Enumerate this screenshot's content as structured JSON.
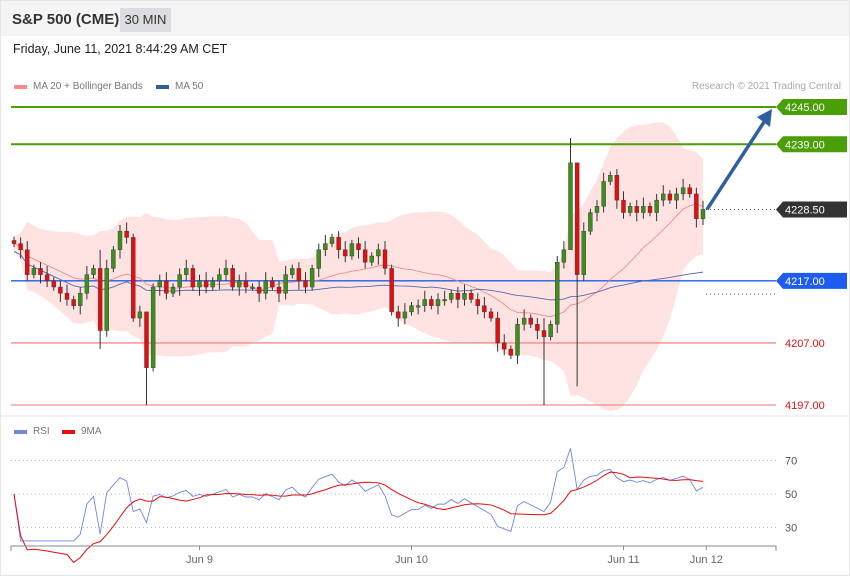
{
  "header": {
    "title": "S&P 500 (CME)",
    "timeframe": "30 MIN",
    "date": "Friday, June 11, 2021 8:44:29 AM CET"
  },
  "legend": {
    "ma20": "MA 20 + Bollinger Bands",
    "ma50": "MA 50",
    "rsi": "RSI",
    "rsi_ma": "9MA",
    "credit": "Research © 2021 Trading Central"
  },
  "colors": {
    "up": "#3e8e1b",
    "down": "#e01010",
    "band": "#ffe3e3",
    "ma20": "#f08080",
    "ma50": "#5566aa",
    "resistance": "#4a9e08",
    "current": "#333333",
    "pivot": "#1e5cf0",
    "support": "#f08c8c",
    "support_text": "#e01010",
    "arrow": "#2e5fa0",
    "rsi": "#6f86e0",
    "rsi_ma": "#e01010"
  },
  "chart_data": {
    "type": "candlestick",
    "ylim": [
      4197,
      4245
    ],
    "levels": [
      {
        "value": 4245,
        "label": "4245.00",
        "kind": "resistance"
      },
      {
        "value": 4239,
        "label": "4239.00",
        "kind": "resistance"
      },
      {
        "value": 4228.5,
        "label": "4228.50",
        "kind": "current"
      },
      {
        "value": 4217,
        "label": "4217.00",
        "kind": "pivot"
      },
      {
        "value": 4207,
        "label": "4207.00",
        "kind": "support"
      },
      {
        "value": 4197,
        "label": "4197.00",
        "kind": "support"
      }
    ],
    "close": [
      4223,
      4222,
      4218,
      4219,
      4218,
      4217,
      4216,
      4215,
      4214,
      4213,
      4215,
      4218,
      4219,
      4209,
      4219,
      4222,
      4225,
      4224,
      4211,
      4212,
      4203,
      4216,
      4217,
      4215,
      4216,
      4218,
      4219,
      4216,
      4217,
      4216,
      4217,
      4218,
      4219,
      4216,
      4217,
      4216,
      4216,
      4215,
      4217,
      4216,
      4215,
      4218,
      4219,
      4217,
      4216,
      4219,
      4222,
      4223,
      4224,
      4222,
      4221,
      4223,
      4222,
      4220,
      4221,
      4222,
      4219,
      4212,
      4211,
      4212,
      4213,
      4213,
      4214,
      4213,
      4214,
      4214,
      4215,
      4214,
      4215,
      4214,
      4213,
      4212,
      4211,
      4207,
      4206,
      4205,
      4210,
      4211,
      4210,
      4209,
      4208,
      4210,
      4220,
      4222,
      4236,
      4218,
      4225,
      4228,
      4229,
      4233,
      4234,
      4230,
      4228,
      4229,
      4228,
      4229,
      4228,
      4230,
      4231,
      4230,
      4231,
      4232,
      4231,
      4227,
      4228.5
    ],
    "wick_overrides": {
      "20": [
        4210,
        4197
      ],
      "13": [
        4222,
        4206
      ],
      "80": [
        4211,
        4197
      ],
      "84": [
        4240,
        4233
      ],
      "85": [
        4236,
        4200
      ]
    },
    "forecast_target": 4245,
    "x_ticks": [
      {
        "label": "Jun 9",
        "index": 28
      },
      {
        "label": "Jun 10",
        "index": 60
      },
      {
        "label": "Jun 11",
        "index": 92
      },
      {
        "label": "Jun 12",
        "index": 104.5
      }
    ],
    "rsi_levels": [
      70,
      50,
      30
    ]
  }
}
